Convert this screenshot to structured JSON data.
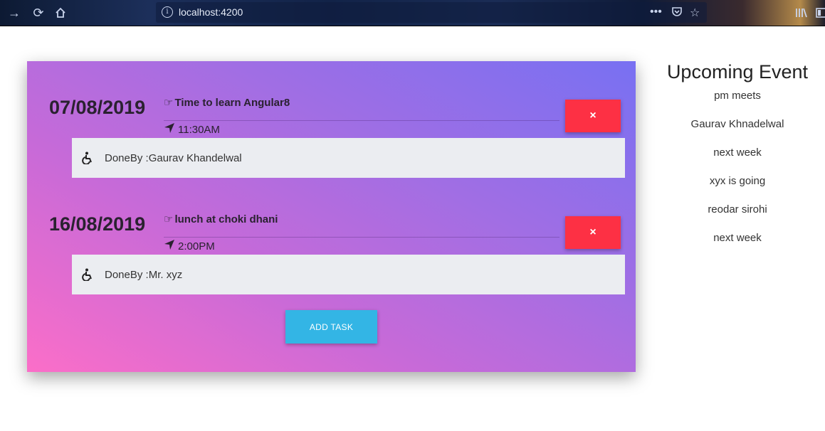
{
  "browser": {
    "url": "localhost:4200"
  },
  "tasks": [
    {
      "date": "07/08/2019",
      "title": "Time to learn Angular8",
      "time": "11:30AM",
      "done_by": "DoneBy :Gaurav Khandelwal",
      "delete_label": "×"
    },
    {
      "date": "16/08/2019",
      "title": "lunch at choki dhani",
      "time": "2:00PM",
      "done_by": "DoneBy :Mr. xyz",
      "delete_label": "×"
    }
  ],
  "add_task_label": "ADD TASK",
  "upcoming": {
    "title": "Upcoming Event",
    "items": [
      "pm meets",
      "Gaurav Khnadelwal",
      "next week",
      "xyx is going",
      "reodar sirohi",
      "next week"
    ]
  },
  "colors": {
    "delete": "#fd3044",
    "add": "#33b5e5",
    "card_start": "#fb6ec8",
    "card_end": "#7870f2"
  }
}
